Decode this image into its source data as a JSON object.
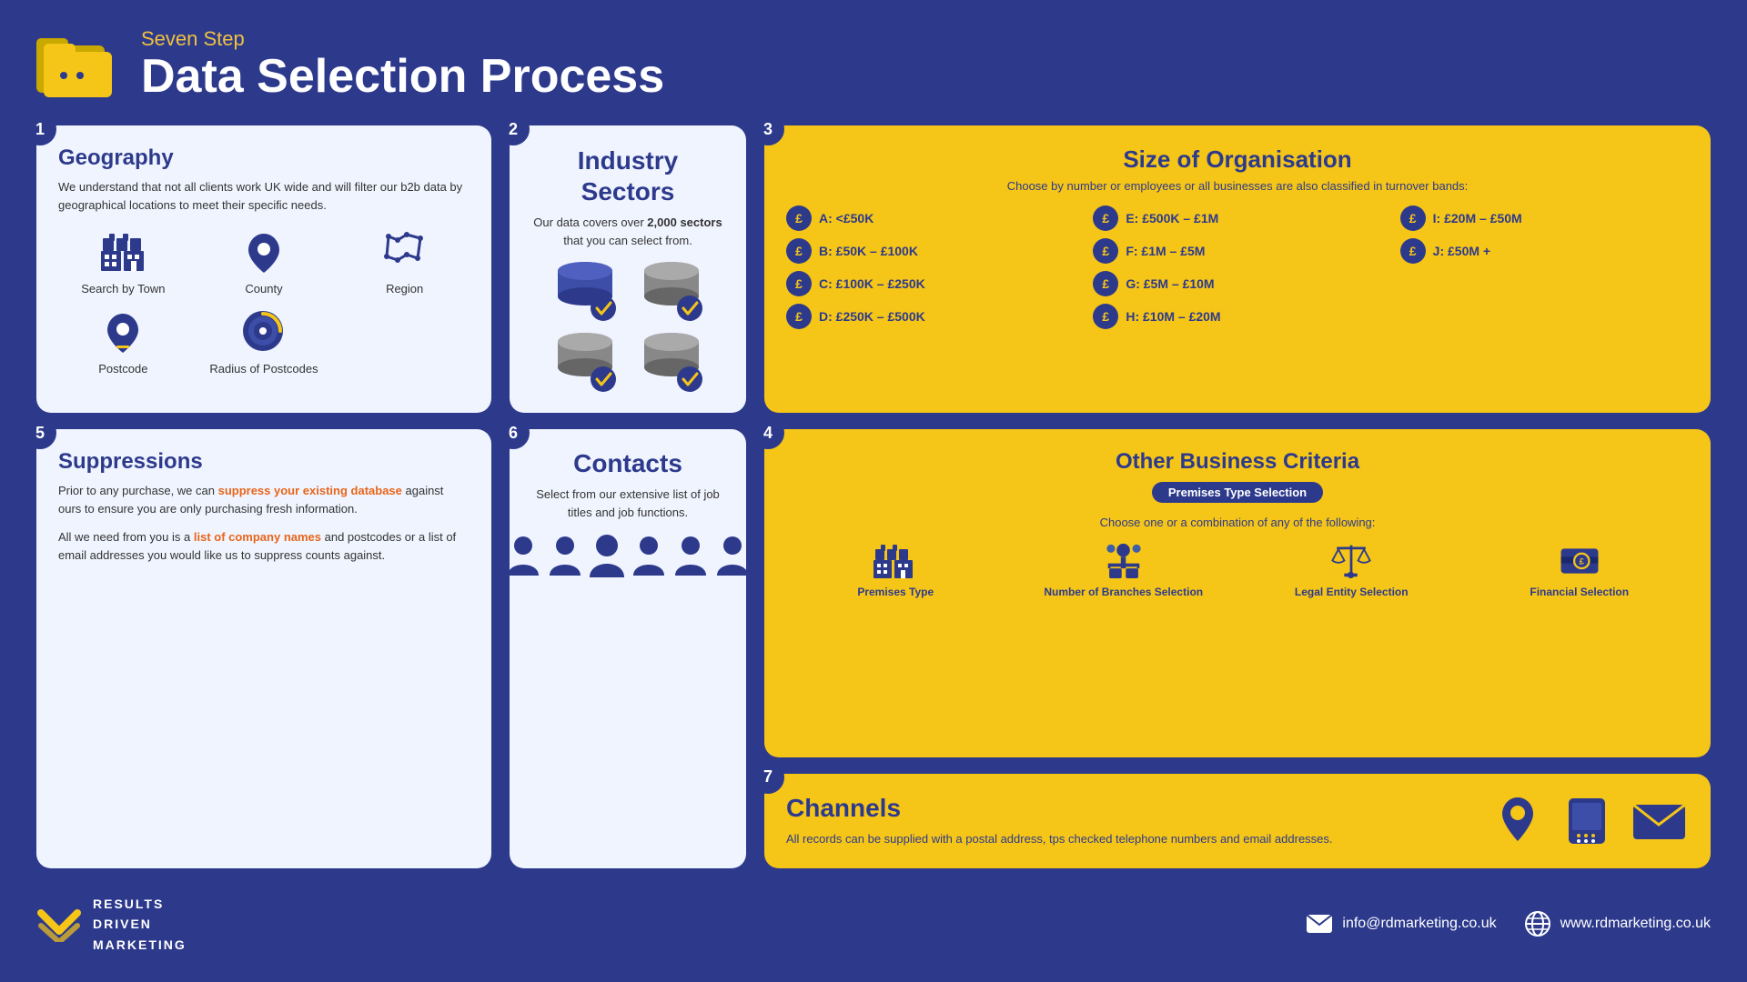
{
  "header": {
    "subtitle": "Seven Step",
    "main_title": "Data Selection Process"
  },
  "steps": {
    "step1": {
      "number": "1",
      "title": "Geography",
      "description": "We understand that not all clients work UK wide and will filter our b2b data by geographical locations to meet their specific needs.",
      "geo_items": [
        {
          "label": "Search by Town",
          "icon": "building"
        },
        {
          "label": "County",
          "icon": "map-pin"
        },
        {
          "label": "Region",
          "icon": "map-region"
        },
        {
          "label": "Postcode",
          "icon": "postcode"
        },
        {
          "label": "Radius of Postcodes",
          "icon": "radius"
        }
      ]
    },
    "step2": {
      "number": "2",
      "title": "Industry Sectors",
      "description": "Our data covers over 2,000 sectors that you can select from.",
      "highlight": "2,000"
    },
    "step3": {
      "number": "3",
      "title": "Size of Organisation",
      "subtitle": "Choose by number or employees or all businesses are also classified in turnover bands:",
      "bands": [
        {
          "id": "A",
          "label": "A: <£50K"
        },
        {
          "id": "B",
          "label": "B: £50K – £100K"
        },
        {
          "id": "C",
          "label": "C: £100K – £250K"
        },
        {
          "id": "D",
          "label": "D: £250K – £500K"
        },
        {
          "id": "E",
          "label": "E: £500K – £1M"
        },
        {
          "id": "F",
          "label": "F: £1M – £5M"
        },
        {
          "id": "G",
          "label": "G: £5M – £10M"
        },
        {
          "id": "H",
          "label": "H: £10M – £20M"
        },
        {
          "id": "I",
          "label": "I: £20M – £50M"
        },
        {
          "id": "J",
          "label": "J: £50M +"
        }
      ]
    },
    "step4": {
      "number": "4",
      "title": "Other Business Criteria",
      "badge": "Premises Type Selection",
      "subtitle": "Choose one or a combination of any of the following:",
      "criteria": [
        {
          "label": "Premises Type",
          "icon": "building2"
        },
        {
          "label": "Number of Branches Selection",
          "icon": "branches"
        },
        {
          "label": "Legal Entity Selection",
          "icon": "legal"
        },
        {
          "label": "Financial Selection",
          "icon": "financial"
        }
      ]
    },
    "step5": {
      "number": "5",
      "title": "Suppressions",
      "description1": "Prior to any purchase, we can",
      "highlight1": "suppress your existing database",
      "description1b": "against ours to ensure you are only purchasing fresh information.",
      "description2": "All we need from you is a",
      "highlight2": "list of company names",
      "description2b": "and postcodes or a list of email addresses you would like us to suppress counts against."
    },
    "step6": {
      "number": "6",
      "title": "Contacts",
      "description": "Select from our extensive list of job titles and job functions."
    },
    "step7": {
      "number": "7",
      "title": "Channels",
      "description": "All records can be supplied with a postal address, tps checked telephone numbers and email addresses."
    }
  },
  "footer": {
    "logo_text": "RESULTS\nDRIVEN\nMARKETING",
    "email": "info@rdmarketing.co.uk",
    "website": "www.rdmarketing.co.uk"
  }
}
